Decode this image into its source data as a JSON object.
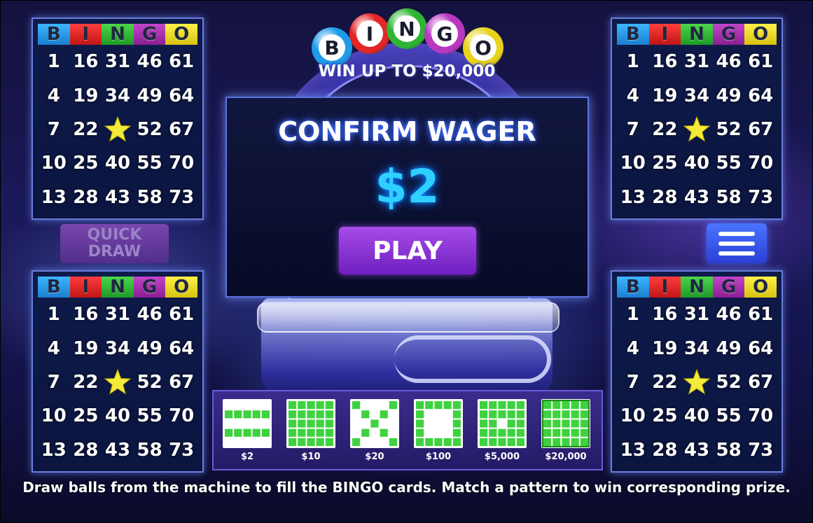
{
  "logo": {
    "balls": [
      {
        "letter": "B",
        "color": "#1e9be9"
      },
      {
        "letter": "I",
        "color": "#e32626"
      },
      {
        "letter": "N",
        "color": "#2fb533"
      },
      {
        "letter": "G",
        "color": "#b838c0"
      },
      {
        "letter": "O",
        "color": "#e8d21a"
      }
    ],
    "subtitle": "WIN UP TO $20,000"
  },
  "cards": [
    {
      "header": [
        "B",
        "I",
        "N",
        "G",
        "O"
      ],
      "rows": [
        [
          "1",
          "16",
          "31",
          "46",
          "61"
        ],
        [
          "4",
          "19",
          "34",
          "49",
          "64"
        ],
        [
          "7",
          "22",
          "FREE",
          "52",
          "67"
        ],
        [
          "10",
          "25",
          "40",
          "55",
          "70"
        ],
        [
          "13",
          "28",
          "43",
          "58",
          "73"
        ]
      ]
    },
    {
      "header": [
        "B",
        "I",
        "N",
        "G",
        "O"
      ],
      "rows": [
        [
          "1",
          "16",
          "31",
          "46",
          "61"
        ],
        [
          "4",
          "19",
          "34",
          "49",
          "64"
        ],
        [
          "7",
          "22",
          "FREE",
          "52",
          "67"
        ],
        [
          "10",
          "25",
          "40",
          "55",
          "70"
        ],
        [
          "13",
          "28",
          "43",
          "58",
          "73"
        ]
      ]
    },
    {
      "header": [
        "B",
        "I",
        "N",
        "G",
        "O"
      ],
      "rows": [
        [
          "1",
          "16",
          "31",
          "46",
          "61"
        ],
        [
          "4",
          "19",
          "34",
          "49",
          "64"
        ],
        [
          "7",
          "22",
          "FREE",
          "52",
          "67"
        ],
        [
          "10",
          "25",
          "40",
          "55",
          "70"
        ],
        [
          "13",
          "28",
          "43",
          "58",
          "73"
        ]
      ]
    },
    {
      "header": [
        "B",
        "I",
        "N",
        "G",
        "O"
      ],
      "rows": [
        [
          "1",
          "16",
          "31",
          "46",
          "61"
        ],
        [
          "4",
          "19",
          "34",
          "49",
          "64"
        ],
        [
          "7",
          "22",
          "FREE",
          "52",
          "67"
        ],
        [
          "10",
          "25",
          "40",
          "55",
          "70"
        ],
        [
          "13",
          "28",
          "43",
          "58",
          "73"
        ]
      ]
    }
  ],
  "free_cell_icon": "star-icon",
  "quick_draw": {
    "line1": "QUICK",
    "line2": "DRAW",
    "state": "disabled"
  },
  "menu_icon": "hamburger-menu-icon",
  "confirm": {
    "title": "CONFIRM WAGER",
    "amount": "$2",
    "play_label": "PLAY"
  },
  "patterns": [
    {
      "prize": "$2",
      "pattern": "two-lines"
    },
    {
      "prize": "$10",
      "pattern": "full-grid"
    },
    {
      "prize": "$20",
      "pattern": "x-shape"
    },
    {
      "prize": "$100",
      "pattern": "frame"
    },
    {
      "prize": "$5,000",
      "pattern": "double-frame"
    },
    {
      "prize": "$20,000",
      "pattern": "blackout"
    }
  ],
  "instructions": "Draw balls from the machine to fill the BINGO cards. Match a pattern to win corresponding prize.",
  "colors": {
    "accent_blue": "#2fd0ff",
    "play_purple": "#8a33d6",
    "pattern_green": "#3fd23f",
    "star_yellow": "#f3ea3a"
  }
}
